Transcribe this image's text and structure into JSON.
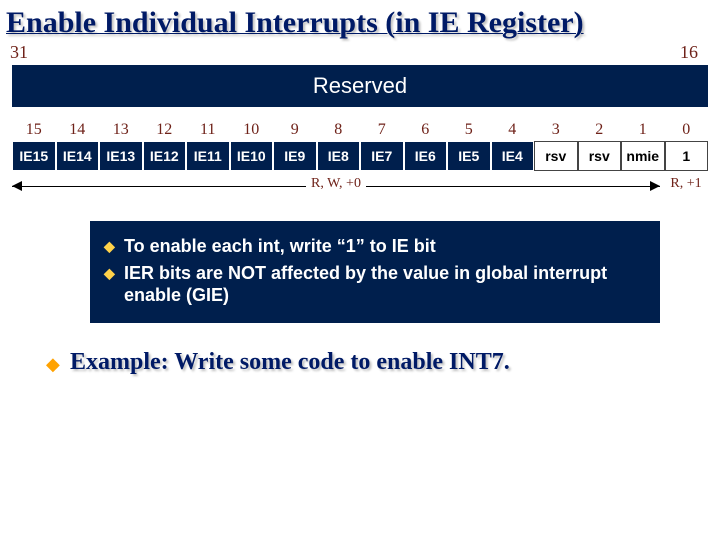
{
  "title": "Enable Individual Interrupts (in IE Register)",
  "upper_range": {
    "left": "31",
    "right": "16"
  },
  "reserved_label": "Reserved",
  "bit_indices": [
    "15",
    "14",
    "13",
    "12",
    "11",
    "10",
    "9",
    "8",
    "7",
    "6",
    "5",
    "4",
    "3",
    "2",
    "1",
    "0"
  ],
  "bit_labels": [
    "IE15",
    "IE14",
    "IE13",
    "IE12",
    "IE11",
    "IE10",
    "IE9",
    "IE8",
    "IE7",
    "IE6",
    "IE5",
    "IE4",
    "rsv",
    "rsv",
    "nmie",
    "1"
  ],
  "bit_light_from_index": 12,
  "rw_label": "R, W, +0",
  "r1_label": "R, +1",
  "bullets": [
    "To enable each int, write “1” to IE bit",
    "IER bits are NOT affected by the value in global interrupt enable (GIE)"
  ],
  "example": "Example: Write some code to enable INT7."
}
